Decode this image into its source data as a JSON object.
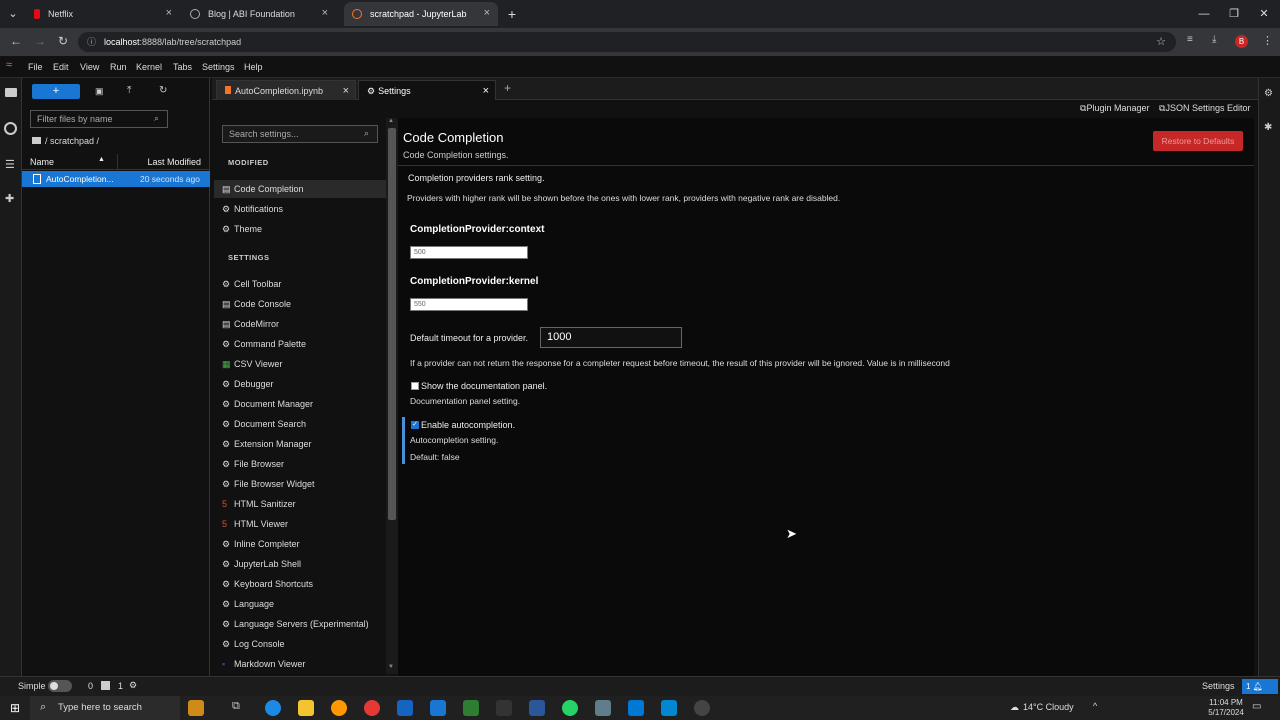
{
  "browser": {
    "tabs": [
      {
        "label": "Netflix",
        "color": "#e50914"
      },
      {
        "label": "Blog | ABI Foundation",
        "color": "#888888"
      },
      {
        "label": "scratchpad - JupyterLab",
        "color": "#f37626"
      }
    ],
    "url_host": "localhost",
    "url_rest": ":8888/lab/tree/scratchpad",
    "profile_letter": "B"
  },
  "menu": [
    "File",
    "Edit",
    "View",
    "Run",
    "Kernel",
    "Tabs",
    "Settings",
    "Help"
  ],
  "filebrowser": {
    "new_label": "+",
    "filter_placeholder": "Filter files by name",
    "breadcrumb": "/ scratchpad /",
    "col_name": "Name",
    "col_modified": "Last Modified",
    "files": [
      {
        "name": "AutoCompletion...",
        "modified": "20 seconds ago"
      }
    ]
  },
  "doctabs": [
    {
      "label": "AutoCompletion.ipynb"
    },
    {
      "label": "Settings"
    }
  ],
  "toolbar": {
    "plugin_manager": "Plugin Manager",
    "json_editor": "JSON Settings Editor"
  },
  "settings_sidebar": {
    "search_placeholder": "Search settings...",
    "modified_header": "MODIFIED",
    "modified": [
      "Code Completion",
      "Notifications",
      "Theme"
    ],
    "settings_header": "SETTINGS",
    "items": [
      "Cell Toolbar",
      "Code Console",
      "CodeMirror",
      "Command Palette",
      "CSV Viewer",
      "Debugger",
      "Document Manager",
      "Document Search",
      "Extension Manager",
      "File Browser",
      "File Browser Widget",
      "HTML Sanitizer",
      "HTML Viewer",
      "Inline Completer",
      "JupyterLab Shell",
      "Keyboard Shortcuts",
      "Language",
      "Language Servers (Experimental)",
      "Log Console",
      "Markdown Viewer"
    ]
  },
  "panel": {
    "title": "Code Completion",
    "subtitle": "Code Completion settings.",
    "restore": "Restore to Defaults",
    "rank_title": "Completion providers rank setting.",
    "rank_desc": "Providers with higher rank will be shown before the ones with lower rank, providers with negative rank are disabled.",
    "context_label": "CompletionProvider:context",
    "context_value": "500",
    "kernel_label": "CompletionProvider:kernel",
    "kernel_value": "550",
    "timeout_label": "Default timeout for a provider.",
    "timeout_value": "1000",
    "timeout_desc": "If a provider can not return the response for a completer request before timeout, the result of this provider will be ignored. Value is in millisecond",
    "doc_label": "Show the documentation panel.",
    "doc_desc": "Documentation panel setting.",
    "auto_label": "Enable autocompletion.",
    "auto_desc": "Autocompletion setting.",
    "auto_default": "Default: false"
  },
  "status": {
    "mode": "Simple",
    "count1": "0",
    "count2": "1",
    "right_label": "Settings",
    "badge": "1"
  },
  "taskbar": {
    "search": "Type here to search",
    "weather": "14°C  Cloudy",
    "time": "11:04 PM",
    "date": "5/17/2024"
  }
}
